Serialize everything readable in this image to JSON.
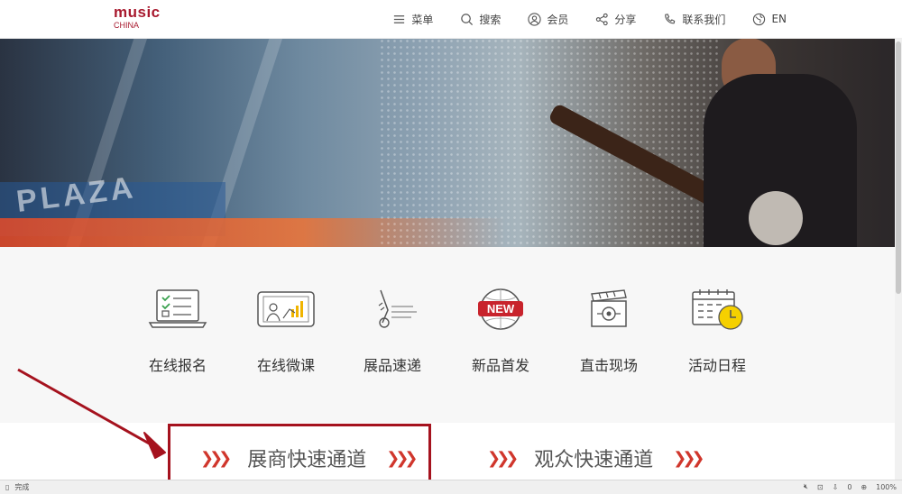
{
  "header": {
    "logo_main": "music",
    "logo_sub": "CHINA",
    "nav": [
      {
        "label": "菜单",
        "icon": "menu-icon"
      },
      {
        "label": "搜索",
        "icon": "search-icon"
      },
      {
        "label": "会员",
        "icon": "user-icon"
      },
      {
        "label": "分享",
        "icon": "share-icon"
      },
      {
        "label": "联系我们",
        "icon": "phone-icon"
      },
      {
        "label": "EN",
        "icon": "globe-icon"
      }
    ]
  },
  "banner": {
    "overlay_text": "PLAZA"
  },
  "services": [
    {
      "label": "在线报名",
      "icon": "registration-laptop-icon"
    },
    {
      "label": "在线微课",
      "icon": "online-course-icon"
    },
    {
      "label": "展品速递",
      "icon": "product-express-icon"
    },
    {
      "label": "新品首发",
      "icon": "new-release-icon",
      "badge": "NEW"
    },
    {
      "label": "直击现场",
      "icon": "live-camera-icon"
    },
    {
      "label": "活动日程",
      "icon": "calendar-clock-icon"
    }
  ],
  "channels": {
    "exhibitor": "展商快速通道",
    "visitor": "观众快速通道"
  },
  "statusbar": {
    "status": "完成",
    "zoom": "100%",
    "count": "0"
  },
  "colors": {
    "brand": "#a8192e",
    "accent": "#d0362c",
    "annotation": "#a5121e"
  }
}
